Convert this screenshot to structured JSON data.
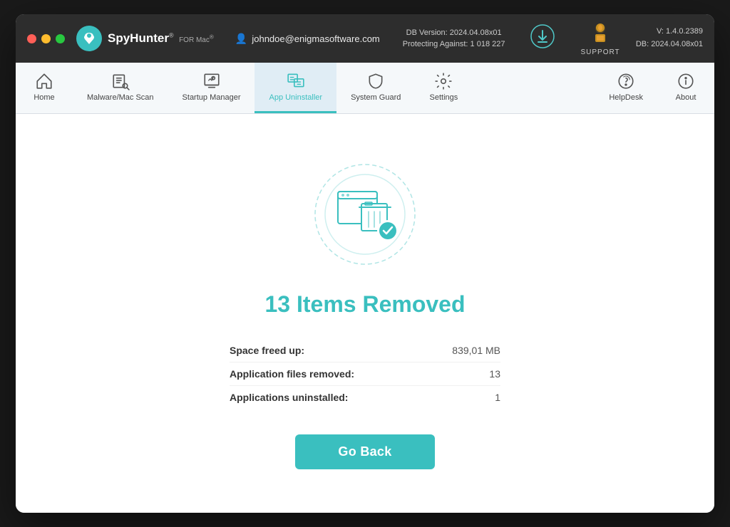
{
  "titlebar": {
    "traffic_lights": [
      "red",
      "yellow",
      "green"
    ],
    "logo_text": "SpyHunter",
    "logo_sup": "®",
    "logo_formac": "FOR Mac®",
    "user_email": "johndoe@enigmasoftware.com",
    "db_version": "DB Version: 2024.04.08x01",
    "protecting": "Protecting Against: 1 018 227",
    "support_label": "SUPPORT",
    "version": "V: 1.4.0.2389",
    "db_label": "DB:  2024.04.08x01"
  },
  "navbar": {
    "items": [
      {
        "label": "Home",
        "icon": "home",
        "active": false
      },
      {
        "label": "Malware/Mac Scan",
        "icon": "scan",
        "active": false
      },
      {
        "label": "Startup Manager",
        "icon": "startup",
        "active": false
      },
      {
        "label": "App Uninstaller",
        "icon": "uninstaller",
        "active": true
      },
      {
        "label": "System Guard",
        "icon": "shield",
        "active": false
      },
      {
        "label": "Settings",
        "icon": "settings",
        "active": false
      }
    ],
    "helpdesk_label": "HelpDesk",
    "about_label": "About"
  },
  "main": {
    "title": "13 Items Removed",
    "stats": [
      {
        "label": "Space freed up:",
        "value": "839,01 MB"
      },
      {
        "label": "Application files removed:",
        "value": "13"
      },
      {
        "label": "Applications uninstalled:",
        "value": "1"
      }
    ],
    "go_back_label": "Go Back"
  },
  "colors": {
    "teal": "#3abfbf",
    "dark_bg": "#2d2d2d"
  }
}
